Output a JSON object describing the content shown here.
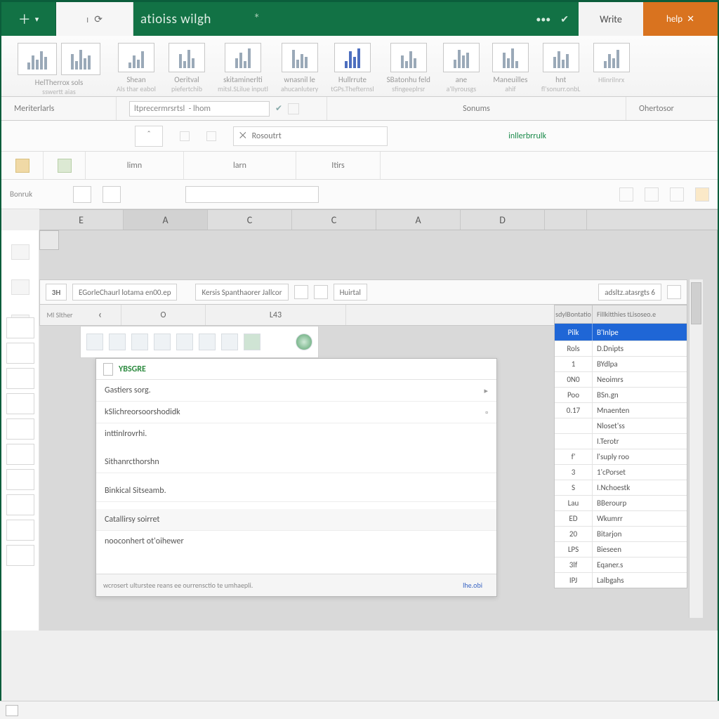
{
  "colors": {
    "brand": "#127245",
    "accent_orange": "#d9731f",
    "header_blue": "#1f66d6"
  },
  "titlebar": {
    "plus_glyph": "＋",
    "chevron_glyph": "▾",
    "left_tab_glyph": "⟳",
    "title": "atioiss wilgh",
    "right_tab": "Write",
    "orange_tab": "help"
  },
  "ribbon": {
    "groups": [
      {
        "label": "HelTherrox sols",
        "sub": "sswertt aias"
      },
      {
        "label": "Shean",
        "sub": "Als thar eabol"
      },
      {
        "label": "Oeritval",
        "sub": "piefertchib"
      },
      {
        "label": "skitaminerlti",
        "sub": "mitsl.SLilue inputl"
      },
      {
        "label": "wnasnil le",
        "sub": "ahucanlutery"
      },
      {
        "label": "Hullrrute",
        "sub": "tGPs.Thefternsl"
      },
      {
        "label": "SBatonhu feld",
        "sub": "sfingeeplrsr"
      },
      {
        "label": "ane",
        "sub": "a'llyrousgs"
      },
      {
        "label": "Maneuilles",
        "sub": "ahif"
      },
      {
        "label": "hnt",
        "sub": "fl'sonurr.onbL"
      },
      {
        "label": "",
        "sub": "Hlinrilnrx"
      }
    ]
  },
  "group_strip": {
    "left": "Meriterlarls",
    "ref_value": "ltprecermrsrtsl  - lhom",
    "center": "Sonums",
    "right": "Ohertosor"
  },
  "row2": {
    "chev_glyph": "＾",
    "cmd_prefix": "⨉",
    "cmd_label": "Rosoutrt",
    "green_label": "inllerbrrulk"
  },
  "row3": {
    "slot1": "limn",
    "slot2": "larn",
    "slot3": "Itirs"
  },
  "row4": {
    "namebox": "Bonruk"
  },
  "columns": [
    "E",
    "A",
    "C",
    "C",
    "A",
    "D",
    ""
  ],
  "columns_selected_index": 1,
  "inner_toolbar": {
    "num": "3H",
    "btn1": "EGorleChaurl lotama en00.ep",
    "btn2": "Kersis Spanthaorer Jallcor",
    "btn3": "Huirtal",
    "btn4": "adsltz.atasrgts 6"
  },
  "inner_tabs": {
    "back_glyph": "‹",
    "tab_a": "O",
    "tab_b": "L43",
    "side_label": "Ml Slther"
  },
  "dialog": {
    "title": "YBSGRE",
    "fields": [
      "Gastiers sorg.",
      "kSlichreorsoorshodidk",
      "inttinlrovrhi.",
      "Sithanrcthorshn",
      "Binkical Sitseamb.",
      "Catallirsy soirret",
      "nooconhert ot'oihewer"
    ],
    "footer_note": "wcrosert ulturstee  reans ee ourrensctio te umhaepli.",
    "footer_ok": "lhe.obi"
  },
  "data_panel": {
    "pre_header_left": "sdylBontatio",
    "pre_header_right": "Fillkitthies tLisoseo.e",
    "col1": "Pilk",
    "col2": "B'Inlpe",
    "rows": [
      {
        "c1": "Rols",
        "c2": "D.Dnipts"
      },
      {
        "c1": "1",
        "c2": "BYdlpa"
      },
      {
        "c1": "0N0",
        "c2": "Neoimrs"
      },
      {
        "c1": "Poo",
        "c2": "BSn.gn"
      },
      {
        "c1": "0.17",
        "c2": "Mnaenten"
      },
      {
        "c1": "",
        "c2": "Nloset'ss"
      },
      {
        "c1": "",
        "c2": "I.Terotr"
      },
      {
        "c1": "f'",
        "c2": "l'suply roo"
      },
      {
        "c1": "3",
        "c2": "1'cPorset"
      },
      {
        "c1": "S",
        "c2": "I.Nchoestk"
      },
      {
        "c1": "Lau",
        "c2": "BBerourp"
      },
      {
        "c1": "ED",
        "c2": "Wkumrr"
      },
      {
        "c1": "20",
        "c2": "Bitarjon"
      },
      {
        "c1": "LPS",
        "c2": "Bieseen"
      },
      {
        "c1": "3lf",
        "c2": "Eqaner.s"
      },
      {
        "c1": "IPJ",
        "c2": "Lalbgahs"
      }
    ]
  }
}
